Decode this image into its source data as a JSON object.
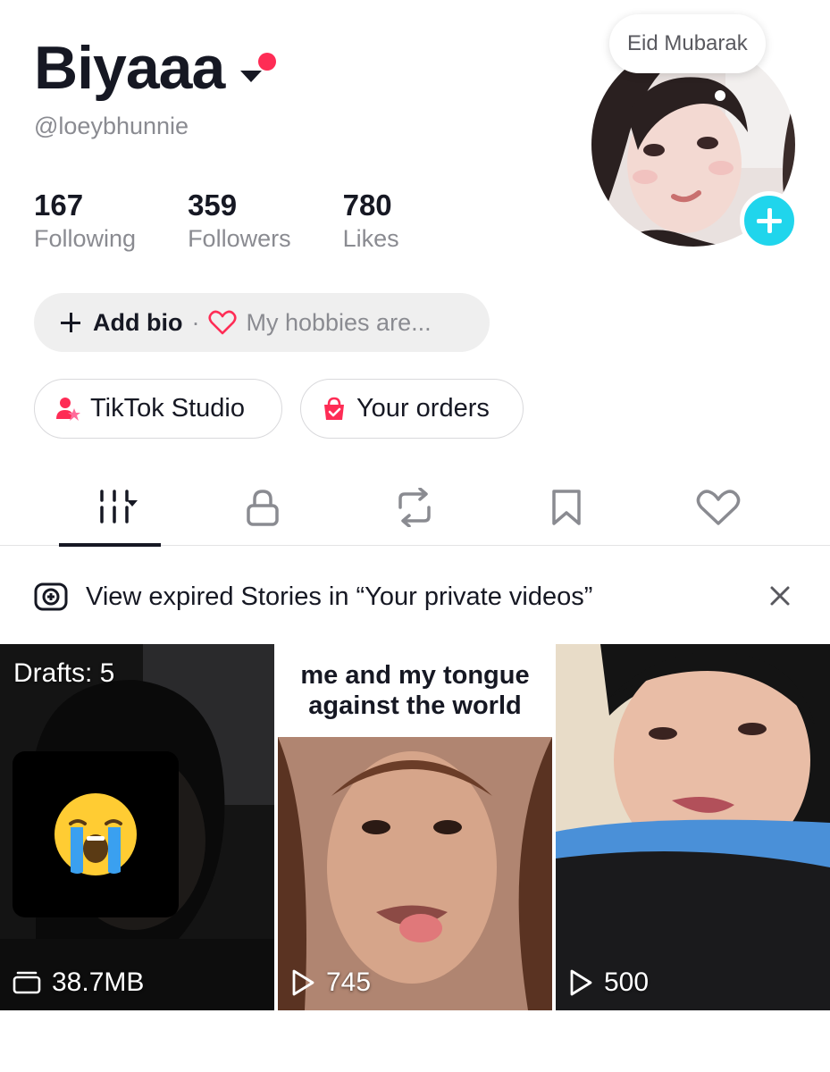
{
  "profile": {
    "display_name": "Biyaaa",
    "username": "@loeybhunnie",
    "note": "Eid Mubarak",
    "stats": [
      {
        "value": "167",
        "label": "Following"
      },
      {
        "value": "359",
        "label": "Followers"
      },
      {
        "value": "780",
        "label": "Likes"
      }
    ]
  },
  "bio": {
    "add_label": "Add bio",
    "separator": "·",
    "hint": "My hobbies are..."
  },
  "quick_actions": {
    "studio_label": "TikTok Studio",
    "orders_label": "Your orders"
  },
  "tabs": [
    "videos-grid-icon",
    "lock-icon",
    "repost-icon",
    "bookmark-icon",
    "heart-icon"
  ],
  "banner": {
    "text": "View expired Stories in “Your private videos”"
  },
  "videos": [
    {
      "drafts_label": "Drafts: 5",
      "size": "38.7MB",
      "emoji": "loudly-crying-face"
    },
    {
      "caption_line1": "me and my tongue",
      "caption_line2": "against the world",
      "views": "745"
    },
    {
      "views": "500"
    }
  ],
  "colors": {
    "accent_red": "#fe2c55",
    "accent_cyan": "#20d5ec",
    "text_primary": "#161823",
    "text_secondary": "#8a8b91"
  }
}
